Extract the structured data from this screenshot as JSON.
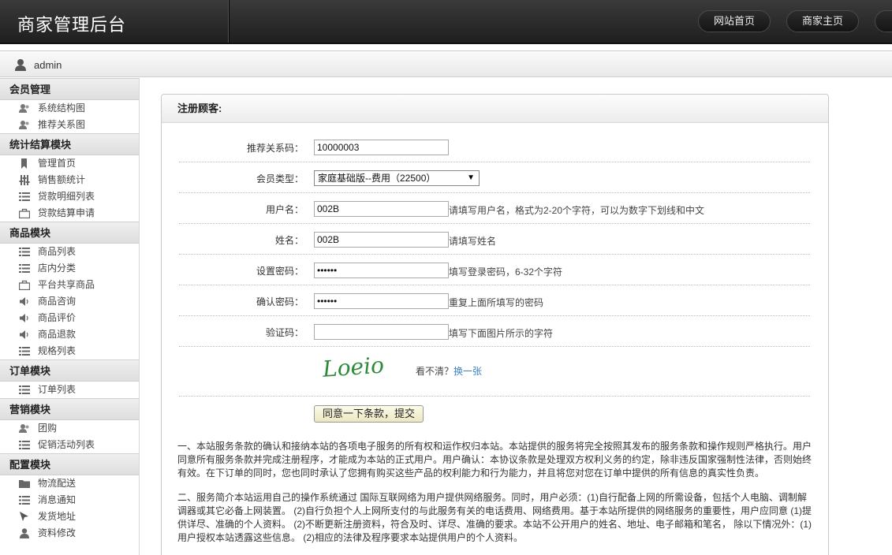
{
  "header": {
    "title": "商家管理后台",
    "nav": [
      "网站首页",
      "商家主页"
    ]
  },
  "user": {
    "name": "admin"
  },
  "sidebar": {
    "sections": [
      {
        "title": "会员管理",
        "items": [
          {
            "label": "系统结构图",
            "icon": "users-icon"
          },
          {
            "label": "推荐关系图",
            "icon": "users-icon"
          }
        ]
      },
      {
        "title": "统计结算模块",
        "items": [
          {
            "label": "管理首页",
            "icon": "bookmark-icon"
          },
          {
            "label": "销售额统计",
            "icon": "sliders-icon"
          },
          {
            "label": "贷款明细列表",
            "icon": "list-icon"
          },
          {
            "label": "贷款结算申请",
            "icon": "briefcase-icon"
          }
        ]
      },
      {
        "title": "商品模块",
        "items": [
          {
            "label": "商品列表",
            "icon": "list-icon"
          },
          {
            "label": "店内分类",
            "icon": "list-icon"
          },
          {
            "label": "平台共享商品",
            "icon": "briefcase-icon"
          },
          {
            "label": "商品咨询",
            "icon": "speaker-icon"
          },
          {
            "label": "商品评价",
            "icon": "speaker-icon"
          },
          {
            "label": "商品退款",
            "icon": "speaker-icon"
          },
          {
            "label": "规格列表",
            "icon": "list-icon"
          }
        ]
      },
      {
        "title": "订单模块",
        "items": [
          {
            "label": "订单列表",
            "icon": "list-icon"
          }
        ]
      },
      {
        "title": "营销模块",
        "items": [
          {
            "label": "团购",
            "icon": "users-icon"
          },
          {
            "label": "促销活动列表",
            "icon": "list-icon"
          }
        ]
      },
      {
        "title": "配置模块",
        "items": [
          {
            "label": "物流配送",
            "icon": "folder-icon"
          },
          {
            "label": "消息通知",
            "icon": "list-icon"
          },
          {
            "label": "发货地址",
            "icon": "cursor-icon"
          },
          {
            "label": "资料修改",
            "icon": "user-icon"
          }
        ]
      }
    ]
  },
  "panel": {
    "title": "注册顾客:",
    "fields": {
      "referral_label": "推荐关系码：",
      "referral_value": "10000003",
      "member_type_label": "会员类型：",
      "member_type_value": "家庭基础版--费用（22500）",
      "username_label": "用户名：",
      "username_value": "002B",
      "username_hint": "请填写用户名，格式为2-20个字符，可以为数字下划线和中文",
      "realname_label": "姓名：",
      "realname_value": "002B",
      "realname_hint": "请填写姓名",
      "password_label": "设置密码：",
      "password_value": "••••••",
      "password_hint": "填写登录密码，6-32个字符",
      "confirm_label": "确认密码：",
      "confirm_value": "••••••",
      "confirm_hint": "重复上面所填写的密码",
      "captcha_label": "验证码：",
      "captcha_value": "",
      "captcha_hint": "填写下面图片所示的字符"
    },
    "captcha": {
      "text": "Loeio",
      "question": "看不清？",
      "refresh": "换一张"
    },
    "submit_label": "同意一下条款，提交",
    "terms": [
      "一、本站服务条款的确认和接纳本站的各项电子服务的所有权和运作权归本站。本站提供的服务将完全按照其发布的服务条款和操作规则严格执行。用户同意所有服务条款并完成注册程序，才能成为本站的正式用户。用户确认：本协议条款是处理双方权利义务的约定，除非违反国家强制性法律，否则始终有效。在下订单的同时，您也同时承认了您拥有购买这些产品的权利能力和行为能力，并且将您对您在订单中提供的所有信息的真实性负责。",
      "二、服务简介本站运用自己的操作系统通过 国际互联网络为用户提供网络服务。同时，用户必须：(1)自行配备上网的所需设备，包括个人电脑、调制解调器或其它必备上网装置。 (2)自行负担个人上网所支付的与此服务有关的电话费用、网络费用。基于本站所提供的网络服务的重要性，用户应同意 (1)提供详尽、准确的个人资料。 (2)不断更新注册资料，符合及时、详尽、准确的要求。本站不公开用户的姓名、地址、电子邮箱和笔名， 除以下情况外：(1)用户授权本站透露这些信息。 (2)相应的法律及程序要求本站提供用户的个人资料。"
    ]
  }
}
